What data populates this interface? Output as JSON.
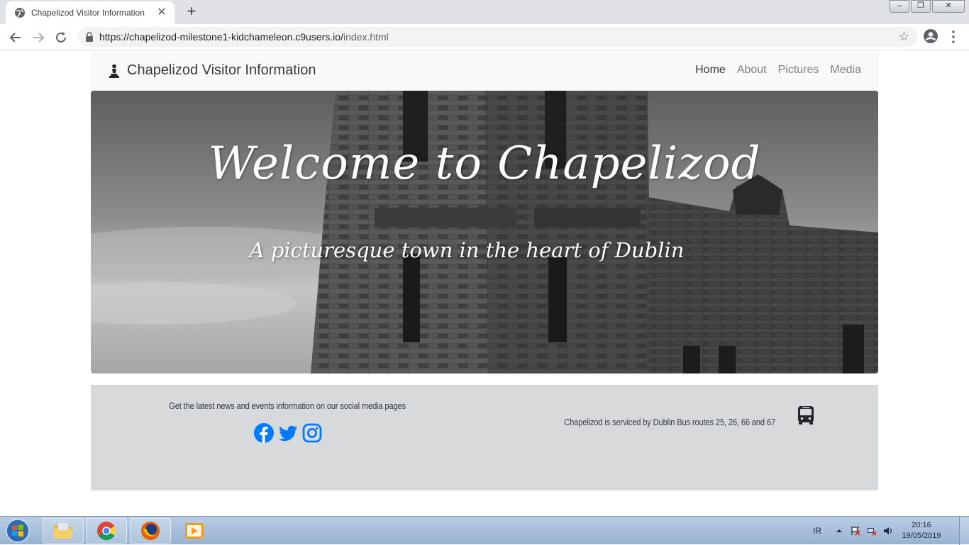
{
  "browser": {
    "tab_title": "Chapelizod Visitor Information",
    "url_host": "https://chapelizod-milestone1-kidchameleon.c9users.io/",
    "url_path": "index.html"
  },
  "site": {
    "brand": "Chapelizod Visitor Information",
    "nav": [
      "Home",
      "About",
      "Pictures",
      "Media"
    ],
    "active_nav": "Home",
    "hero_title": "Welcome to Chapelizod",
    "hero_subtitle": "A picturesque town in the heart of Dublin",
    "footer_left_text": "Get the latest news and events information on our social media pages",
    "footer_right_text": "Chapelizod is serviced by Dublin Bus routes 25, 26, 66 and 67",
    "social_icons": [
      "facebook-icon",
      "twitter-icon",
      "instagram-icon"
    ],
    "accent_color": "#007bff"
  },
  "taskbar": {
    "language": "IR",
    "time": "20:16",
    "date": "19/05/2019"
  }
}
